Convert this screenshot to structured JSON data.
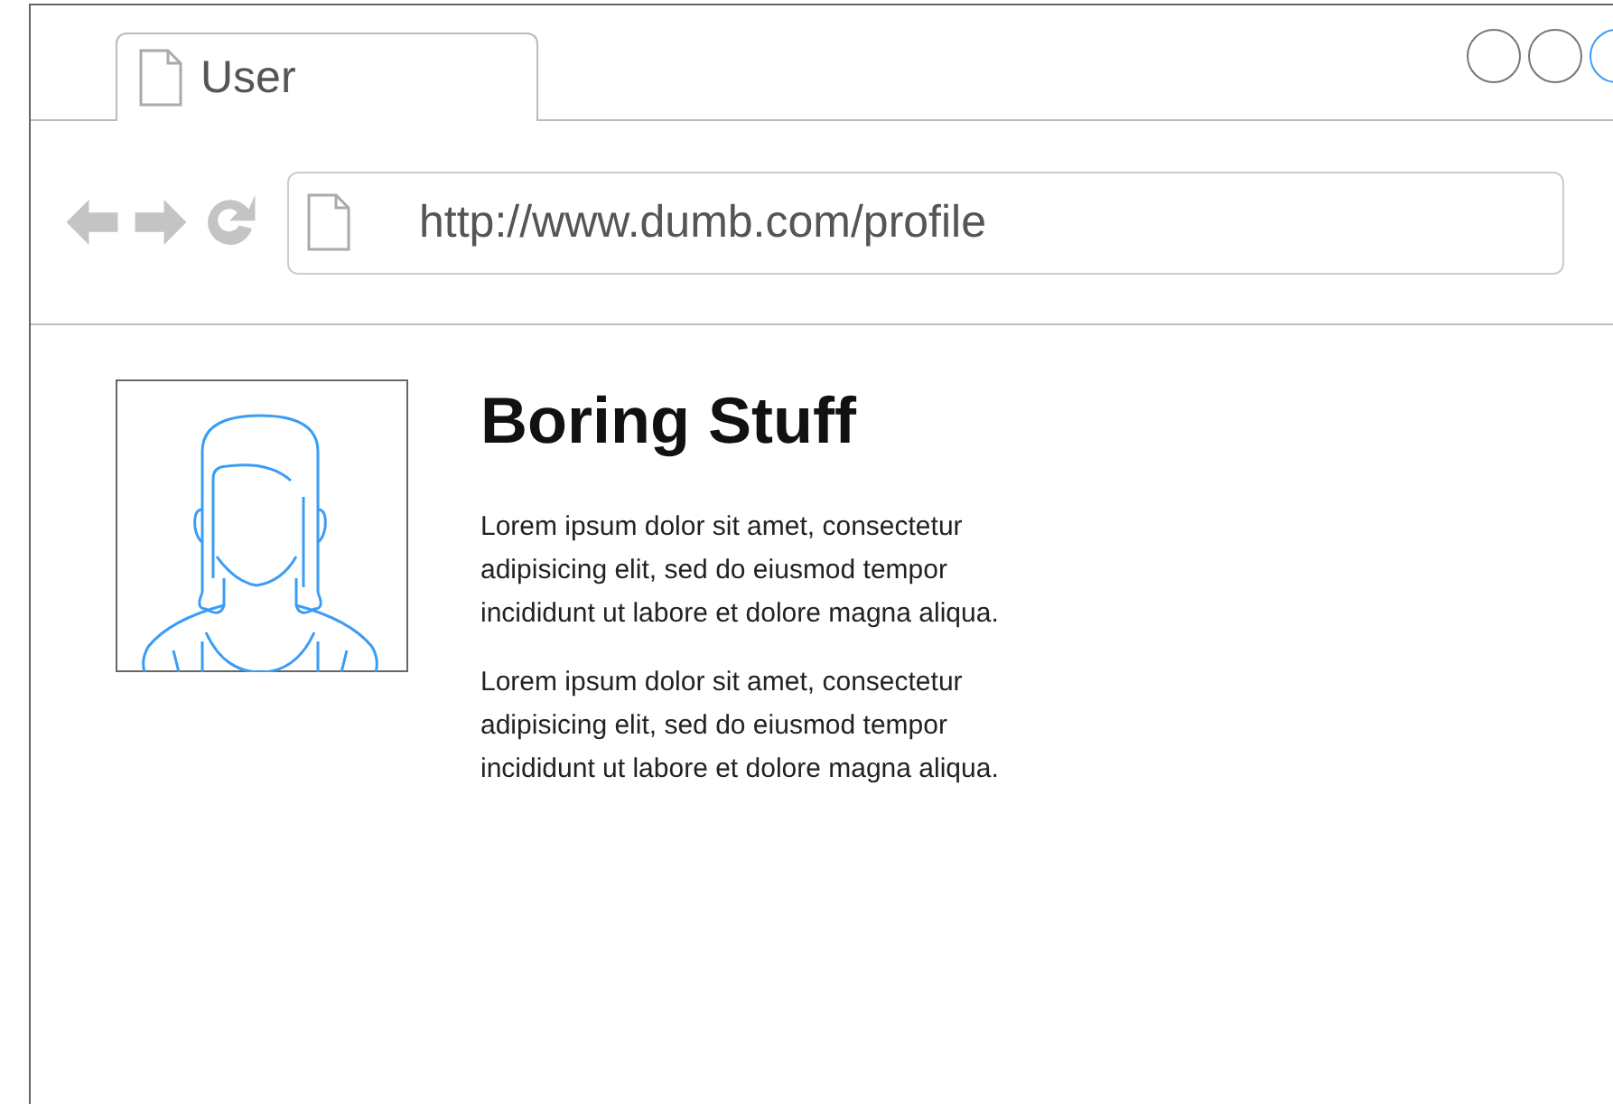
{
  "tab": {
    "title": "User"
  },
  "window_controls": [
    {
      "selected": false
    },
    {
      "selected": false
    },
    {
      "selected": true
    }
  ],
  "address_bar": {
    "value": "http://www.dumb.com/profile"
  },
  "profile": {
    "heading": "Boring Stuff",
    "paragraphs": [
      "Lorem ipsum dolor sit amet, consectetur adipisicing elit, sed do eiusmod tempor incididunt ut labore et dolore magna aliqua.",
      "Lorem ipsum dolor sit amet, consectetur adipisicing elit, sed do eiusmod tempor incididunt ut labore et dolore magna aliqua."
    ]
  }
}
